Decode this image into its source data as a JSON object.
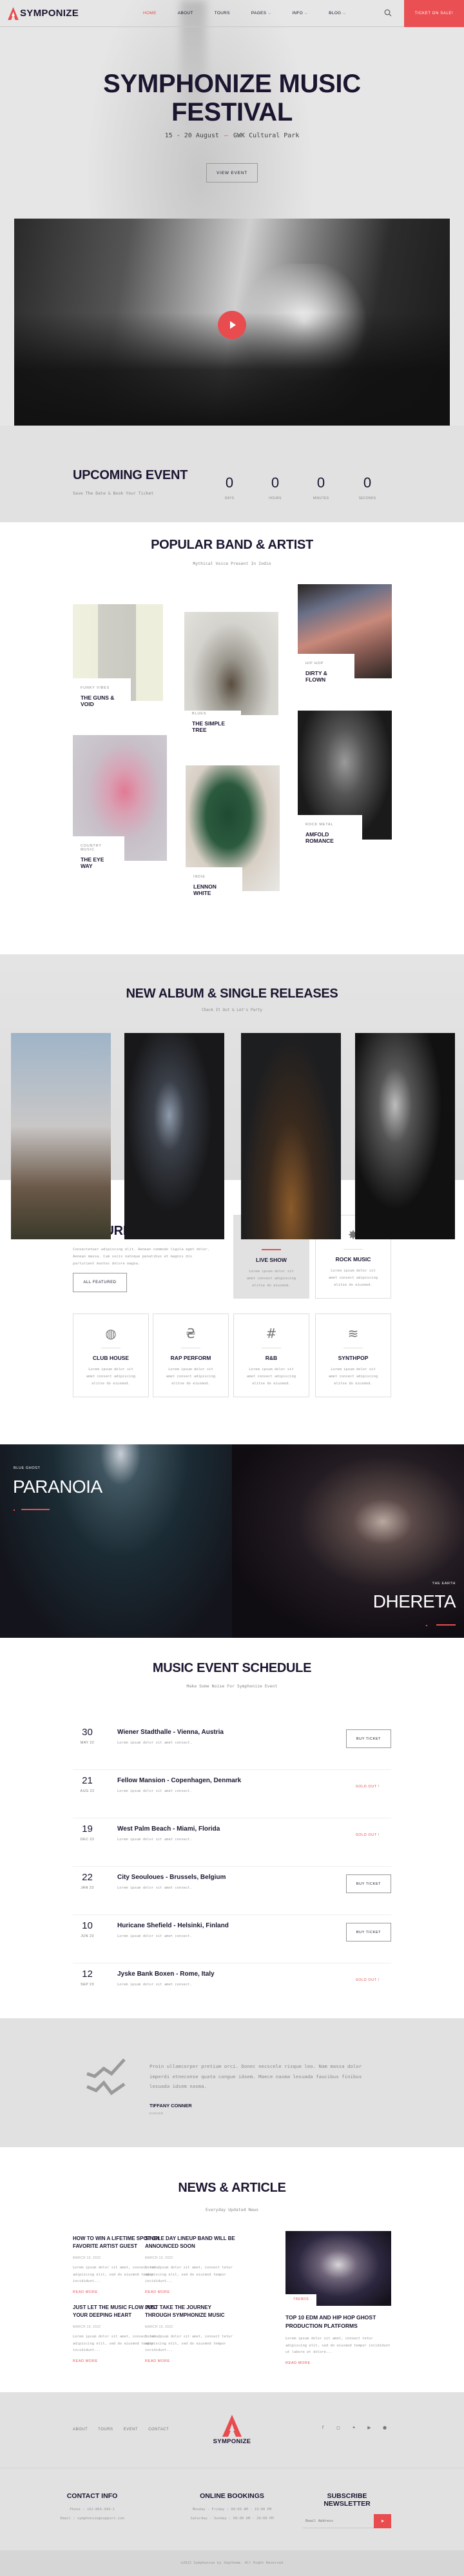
{
  "header": {
    "brand": "SYMPONIZE",
    "nav": [
      {
        "label": "HOME",
        "active": true,
        "dropdown": false
      },
      {
        "label": "ABOUT",
        "active": false,
        "dropdown": false
      },
      {
        "label": "TOURS",
        "active": false,
        "dropdown": false
      },
      {
        "label": "PAGES",
        "active": false,
        "dropdown": true
      },
      {
        "label": "INFO",
        "active": false,
        "dropdown": true
      },
      {
        "label": "BLOG",
        "active": false,
        "dropdown": true
      }
    ],
    "search_icon": "search-icon",
    "cta": "TICKET ON SALE!"
  },
  "hero": {
    "title_line1": "SYMPHONIZE MUSIC",
    "title_line2": "FESTIVAL",
    "dates": "15 - 20 August",
    "location": "GWK Cultural Park",
    "button": "VIEW EVENT",
    "video_icon": "play-icon"
  },
  "countdown": {
    "title": "UPCOMING EVENT",
    "subtitle": "Save The Date & Book Your Ticket",
    "units": [
      {
        "value": "0",
        "label": "DAYS"
      },
      {
        "value": "0",
        "label": "HOURS"
      },
      {
        "value": "0",
        "label": "MINUTES"
      },
      {
        "value": "0",
        "label": "SECONDS"
      }
    ]
  },
  "bands": {
    "title": "POPULAR BAND & ARTIST",
    "subtitle": "Mythical Voice Present In Indio",
    "items": [
      {
        "genre": "FUNKY VIBES",
        "name": "THE GUNS & VOID"
      },
      {
        "genre": "BLUES",
        "name": "THE SIMPLE TREE"
      },
      {
        "genre": "HIP HOP",
        "name": "DIRTY & FLOWN"
      },
      {
        "genre": "COUNTRY MUSIC",
        "name": "THE EYE WAY"
      },
      {
        "genre": "INDIE",
        "name": "LENNON WHITE"
      },
      {
        "genre": "ROCK METAL",
        "name": "AMFOLD ROMANCE"
      }
    ]
  },
  "albums": {
    "title": "NEW ALBUM & SINGLE RELEASES",
    "subtitle": "Check It Out & Let's Party"
  },
  "featured": {
    "title": "FEATURED OFFER",
    "description": "Consectetuer adipiscing elit. Aenean commodo ligula eget dolor. Aenean massa. Cum socis natoque penatibus et magnis dis parturient montes dolore magna.",
    "button": "ALL FEATURED",
    "cards": [
      {
        "icon": "asterisk-icon",
        "glyph": "✱",
        "title": "LIVE SHOW",
        "text": "Lorem ipsum dolor sit amet consect adipiscing elitse do eiusmod."
      },
      {
        "icon": "star-burst-icon",
        "glyph": "✸",
        "title": "ROCK MUSIC",
        "text": "Lorem ipsum dolor sit amet consect adipiscing elitse do eiusmod."
      },
      {
        "icon": "disco-ball-icon",
        "glyph": "◍",
        "title": "CLUB HOUSE",
        "text": "Lorem ipsum dolor sit amet consect adipiscing elitse do eiusmod."
      },
      {
        "icon": "hryvnia-icon",
        "glyph": "₴",
        "title": "RAP PERFORM",
        "text": "Lorem ipsum dolor sit amet consect adipiscing elitse do eiusmod."
      },
      {
        "icon": "hash-icon",
        "glyph": "#",
        "title": "R&B",
        "text": "Lorem ipsum dolor sit amet consect adipiscing elitse do eiusmod."
      },
      {
        "icon": "waves-icon",
        "glyph": "≋",
        "title": "SYNTHPOP",
        "text": "Lorem ipsum dolor sit amet consect adipiscing elitse do eiusmod."
      }
    ]
  },
  "split": {
    "left": {
      "tag": "BLUE GHOST",
      "name": "PARANOIA"
    },
    "right": {
      "tag": "THE EARTH",
      "name": "DHERETA"
    }
  },
  "schedule": {
    "title": "MUSIC EVENT SCHEDULE",
    "subtitle": "Make Some Noise For Symphonize Event",
    "events": [
      {
        "day": "30",
        "month": "MAY 22",
        "venue": "Wiener Stadthalle - Vienna, Austria",
        "desc": "Lorem ipsum dolor sit amet consect.",
        "status": "buy",
        "action": "BUY TICKET"
      },
      {
        "day": "21",
        "month": "AUG 22",
        "venue": "Fellow Mansion - Copenhagen, Denmark",
        "desc": "Lorem ipsum dolor sit amet consect.",
        "status": "sold",
        "action": "SOLD OUT !"
      },
      {
        "day": "19",
        "month": "DEC 22",
        "venue": "West Palm Beach - Miami, Florida",
        "desc": "Lorem ipsum dolor sit amet consect.",
        "status": "sold",
        "action": "SOLD OUT !"
      },
      {
        "day": "22",
        "month": "JAN 23",
        "venue": "City Seouloues - Brussels, Belgium",
        "desc": "Lorem ipsum dolor sit amet consect.",
        "status": "buy",
        "action": "BUY TICKET"
      },
      {
        "day": "10",
        "month": "JUN 23",
        "venue": "Huricane Shefield - Helsinki, Finland",
        "desc": "Lorem ipsum dolor sit amet consect.",
        "status": "buy",
        "action": "BUY TICKET"
      },
      {
        "day": "12",
        "month": "SEP 23",
        "venue": "Jyske Bank Boxen - Rome, Italy",
        "desc": "Lorem ipsum dolor sit amet consect.",
        "status": "sold",
        "action": "SOLD OUT !"
      }
    ]
  },
  "testimonial": {
    "text": "Proin ullamcorper pretium orci. Donec necscele risque leo. Nam massa dolor imperdi etneconse quata congue idsem. Maece nasma lesuada faucibus finibus lesuada idsem nasma.",
    "name": "TIFFANY CONNER",
    "role": "DANCER"
  },
  "news": {
    "title": "NEWS & ARTICLE",
    "subtitle": "Everyday Updated News",
    "posts": [
      {
        "title": "HOW TO WIN A LIFETIME SPOT ON FAVORITE ARTIST GUEST",
        "date": "MARCH 19, 2022",
        "excerpt": "Lorem ipsum dolor sit amet, consect tetur adipiscing elit, sed do eiusmod tempor incididunt...",
        "link": "READ MORE"
      },
      {
        "title": "SINGLE DAY LINEUP BAND WILL BE ANNOUNCED SOON",
        "date": "MARCH 19, 2022",
        "excerpt": "Lorem ipsum dolor sit amet, consect tetur adipiscing elit, sed do eiusmod tempor incididunt...",
        "link": "READ MORE"
      },
      {
        "title": "JUST LET THE MUSIC FLOW INTO YOUR DEEPING HEART",
        "date": "MARCH 19, 2022",
        "excerpt": "Lorem ipsum dolor sit amet, consect tetur adipiscing elit, sed do eiusmod tempor incididunt...",
        "link": "READ MORE"
      },
      {
        "title": "JUST TAKE THE JOURNEY THROUGH SYMPHONIZE MUSIC",
        "date": "MARCH 19, 2022",
        "excerpt": "Lorem ipsum dolor sit amet, consect tetur adipiscing elit, sed do eiusmod tempor incididunt...",
        "link": "READ MORE"
      }
    ],
    "feature": {
      "tag": "TRENDS",
      "title": "TOP 10 EDM AND HIP HOP GHOST PRODUCTION PLATFORMS",
      "excerpt": "Lorem ipsum dolor sit amet, consect tetur adipiscing elit, sed do eiusmod tempor incididunt ut labore et dolore...",
      "link": "READ MORE"
    }
  },
  "footer": {
    "links": [
      "ABOUT",
      "TOURS",
      "EVENT",
      "CONTACT"
    ],
    "brand": "SYMPONIZE",
    "social": [
      {
        "icon": "facebook-icon",
        "glyph": "f"
      },
      {
        "icon": "instagram-icon",
        "glyph": "◻"
      },
      {
        "icon": "twitter-icon",
        "glyph": "✦"
      },
      {
        "icon": "youtube-icon",
        "glyph": "▶"
      },
      {
        "icon": "spotify-icon",
        "glyph": "●"
      }
    ],
    "contact": {
      "title": "CONTACT INFO",
      "phone": "Phone : +62-864-349-1",
      "email": "Email : symphonize@support.com"
    },
    "bookings": {
      "title": "ONLINE BOOKINGS",
      "weekday": "Monday - Friday : 09:00 AM - 19:00 PM",
      "weekend": "Saturday - Sunday : 09:00 AM - 20:00 PM"
    },
    "newsletter": {
      "title": "SUBSCRIBE NEWSLETTER",
      "placeholder": "Email Address",
      "send_icon": "send-icon"
    },
    "copyright": "©2022 Symphonize by Jegtheme. All Right Reserved"
  },
  "colors": {
    "accent": "#e84c4f",
    "dark": "#1c1530",
    "panel": "#e1e1e2"
  }
}
